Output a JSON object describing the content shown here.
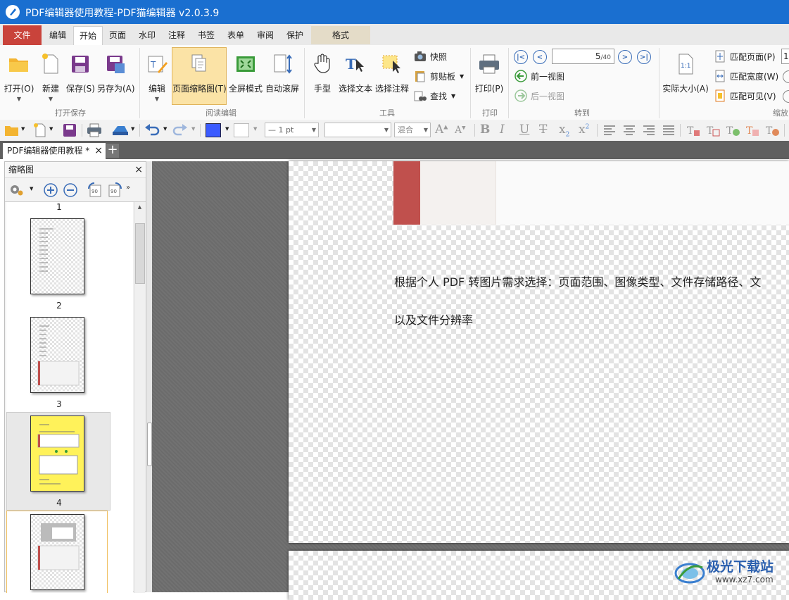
{
  "window": {
    "title": "PDF编辑器使用教程-PDF猫编辑器 v2.0.3.9"
  },
  "ribbon_tabs": [
    "文件",
    "编辑",
    "开始",
    "页面",
    "水印",
    "注释",
    "书签",
    "表单",
    "审阅",
    "保护",
    "格式"
  ],
  "active_tab": "开始",
  "ribbon": {
    "open": "打开(O)",
    "new": "新建",
    "save": "保存(S)",
    "save_as": "另存为(A)",
    "group_open_save": "打开保存",
    "edit": "编辑",
    "page_thumbs": "页面缩略图(T)",
    "fullscreen": "全屏模式",
    "autoscroll": "自动滚屏",
    "group_read_edit": "阅读编辑",
    "hand": "手型",
    "select_text": "选择文本",
    "select_annot": "选择注释",
    "snapshot": "快照",
    "clipboard": "剪贴板",
    "find": "查找",
    "group_tools": "工具",
    "print": "打印(P)",
    "group_print": "打印",
    "page_current": "5",
    "page_total": "/40",
    "prev_view": "前一视图",
    "next_view": "后一视图",
    "group_goto": "转到",
    "actual_size": "实际大小(A)",
    "fit_page": "匹配页面(P)",
    "fit_width": "匹配宽度(W)",
    "fit_visible": "匹配可见(V)",
    "zoom_value": "1",
    "group_zoom": "缩放"
  },
  "toolbar2": {
    "line_width": "1 pt",
    "blend_mode": "混合",
    "fill_color": "#3b5bff"
  },
  "doc_tab": {
    "label": "PDF编辑器使用教程 *"
  },
  "thumb_panel": {
    "title": "缩略图",
    "page_labels": [
      "1",
      "2",
      "3",
      "4"
    ],
    "selected_page": "4"
  },
  "page_content": {
    "line1": "根据个人 PDF 转图片需求选择：页面范围、图像类型、文件存储路径、文",
    "line2": "以及文件分辨率"
  },
  "watermark": {
    "name": "极光下载站",
    "url": "www.xz7.com"
  },
  "colors": {
    "titlebar": "#1a6fd0",
    "file_tab": "#c9433b",
    "accent_red": "#c0504d"
  }
}
